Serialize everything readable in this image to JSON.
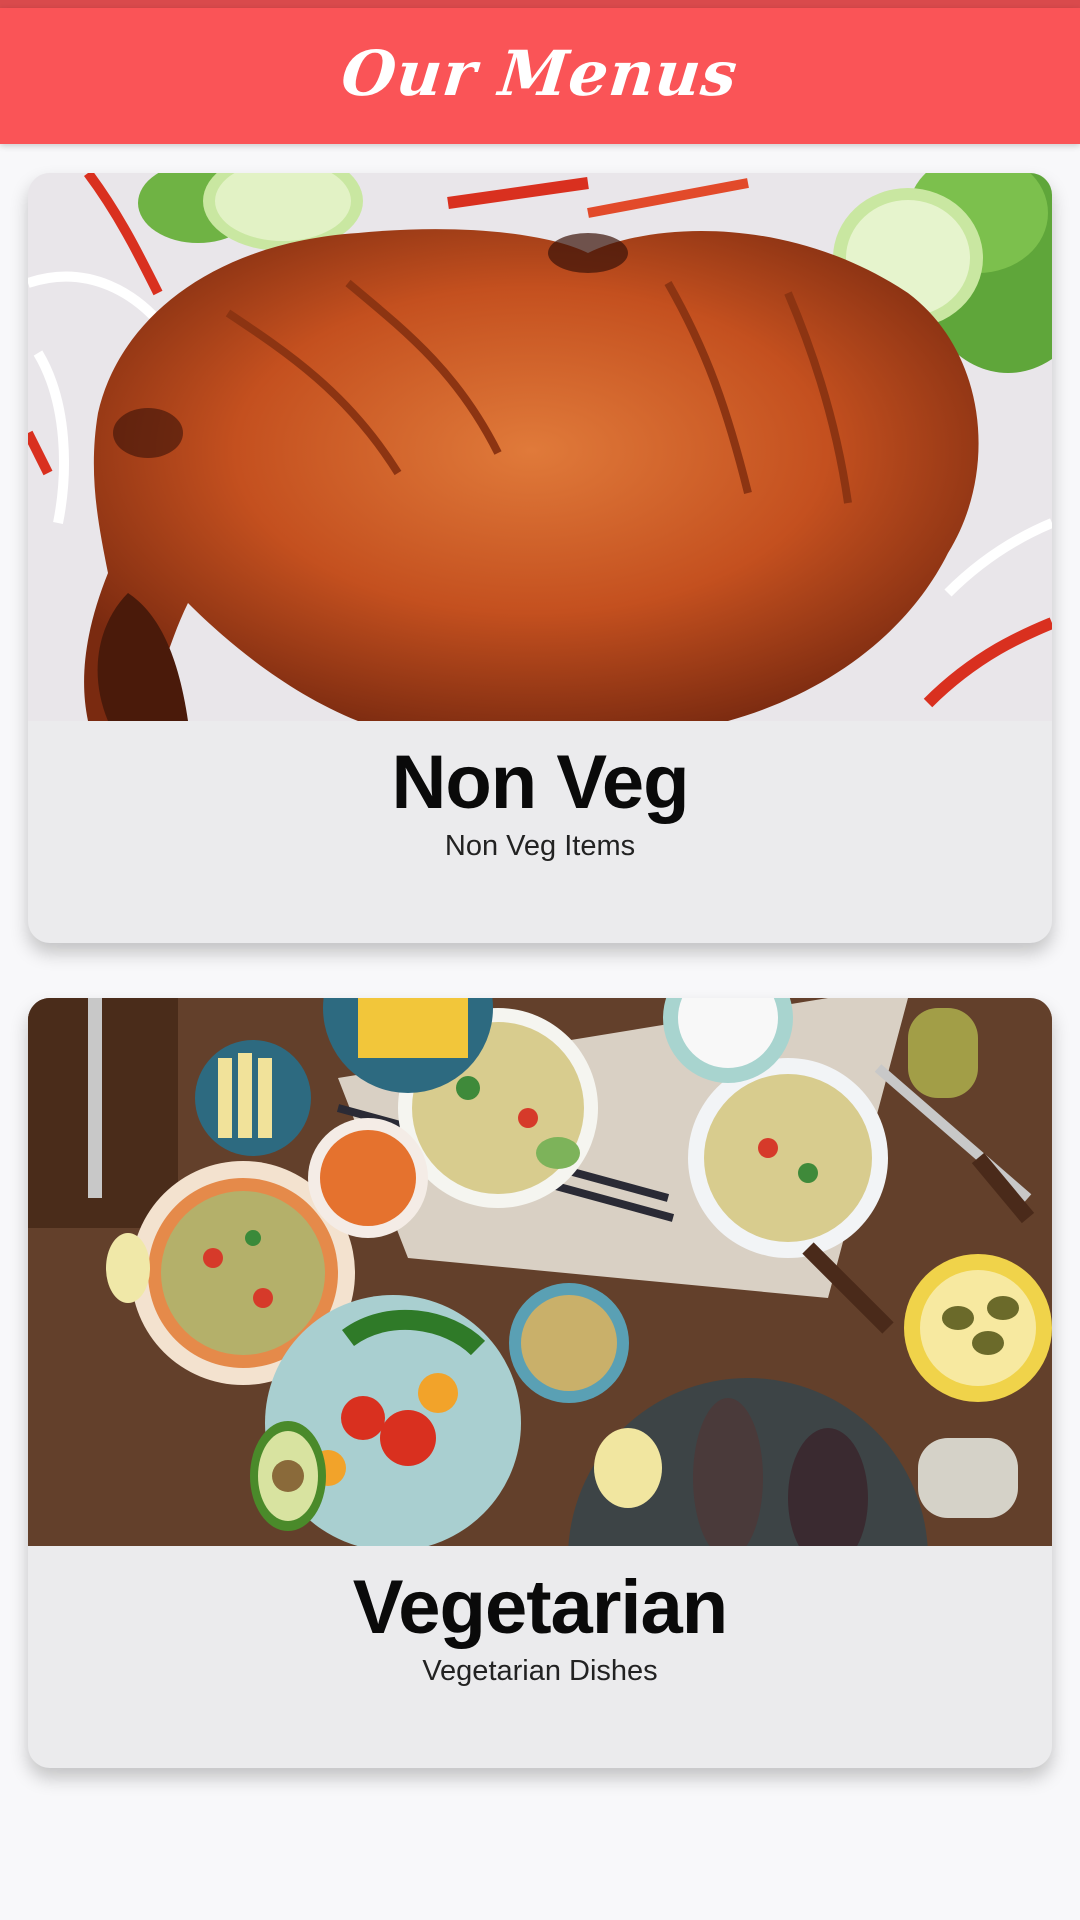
{
  "header": {
    "title": "Our Menus",
    "background_color": "#fa5457",
    "title_color": "#ffffff"
  },
  "menus": [
    {
      "title": "Non Veg",
      "subtitle": "Non Veg Items",
      "image_icon": "tandoori-chicken-photo"
    },
    {
      "title": "Vegetarian",
      "subtitle": "Vegetarian Dishes",
      "image_icon": "vegetarian-table-spread-photo"
    }
  ],
  "colors": {
    "card_background": "#ebebed",
    "page_background": "#f8f8fa"
  }
}
